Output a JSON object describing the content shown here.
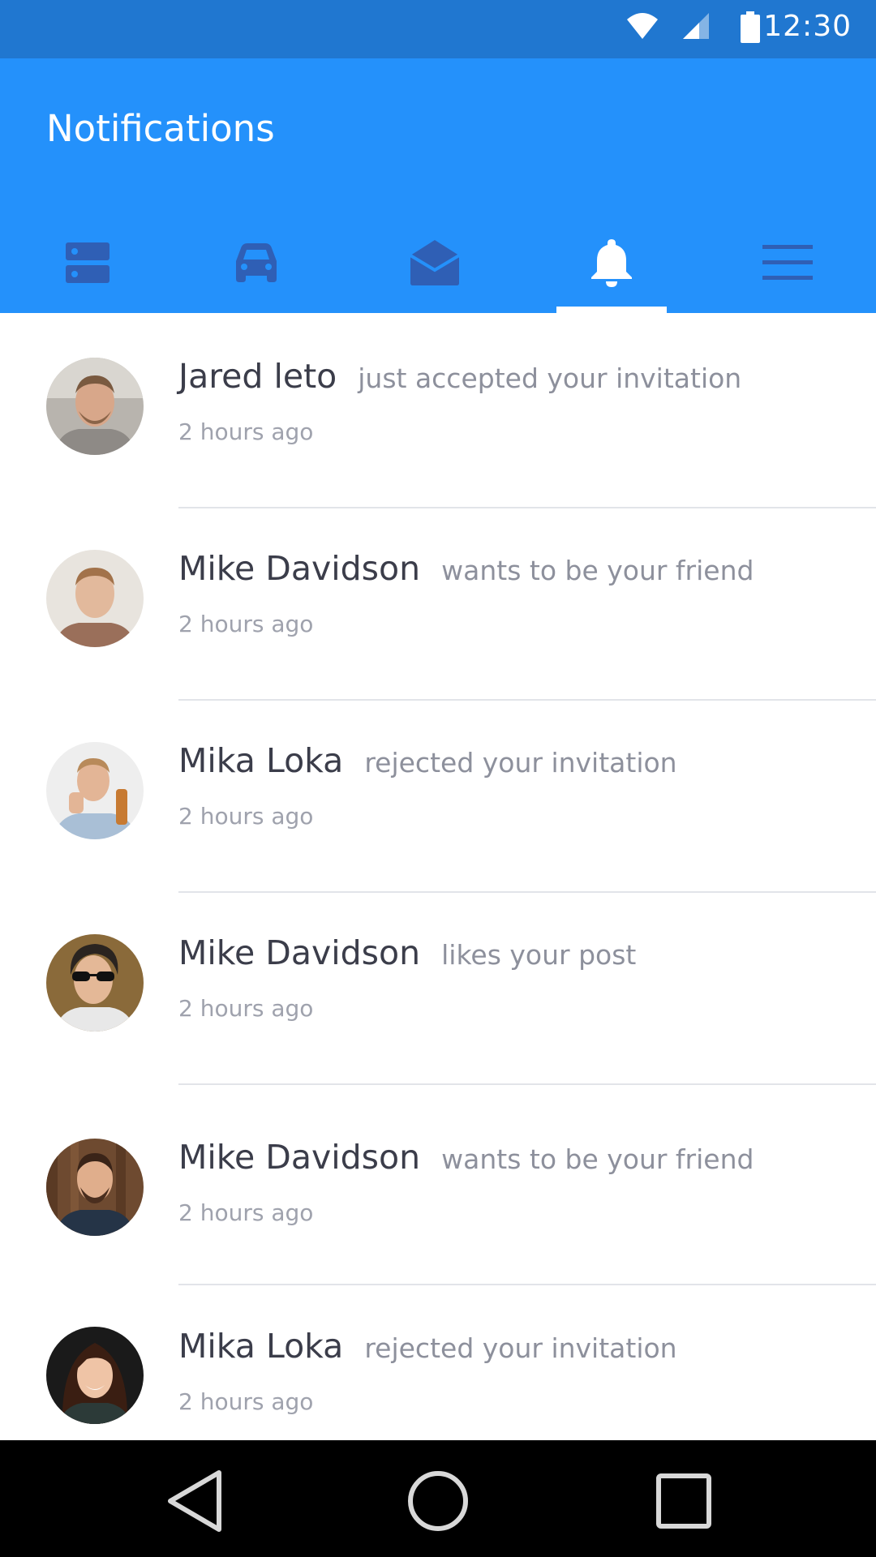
{
  "status_bar": {
    "time": "12:30",
    "icons": [
      "wifi-icon",
      "cell-signal-icon",
      "battery-icon"
    ]
  },
  "app_bar": {
    "title": "Notifications",
    "tabs": [
      {
        "icon": "storage-icon",
        "active": false
      },
      {
        "icon": "car-icon",
        "active": false
      },
      {
        "icon": "mail-open-icon",
        "active": false
      },
      {
        "icon": "bell-icon",
        "active": true
      },
      {
        "icon": "menu-icon",
        "active": false
      }
    ]
  },
  "notifications": [
    {
      "name": "Jared leto",
      "action": "just accepted your invitation",
      "time": "2 hours ago"
    },
    {
      "name": "Mike Davidson",
      "action": "wants to be your friend",
      "time": "2 hours ago"
    },
    {
      "name": "Mika Loka",
      "action": "rejected your invitation",
      "time": "2 hours ago"
    },
    {
      "name": "Mike Davidson",
      "action": "likes your post",
      "time": "2 hours ago"
    },
    {
      "name": "Mike Davidson",
      "action": "wants to be your friend",
      "time": "2 hours ago"
    },
    {
      "name": "Mika Loka",
      "action": "rejected your invitation",
      "time": "2 hours ago"
    }
  ],
  "nav_bar": {
    "buttons": [
      "back-icon",
      "home-icon",
      "recents-icon"
    ]
  },
  "colors": {
    "status_bar": "#2077d0",
    "app_bar": "#2491fb",
    "tab_icon_inactive": "#2f5fb5",
    "tab_icon_active": "#ffffff",
    "name_text": "#3b3d4a",
    "action_text": "#8d909c"
  }
}
